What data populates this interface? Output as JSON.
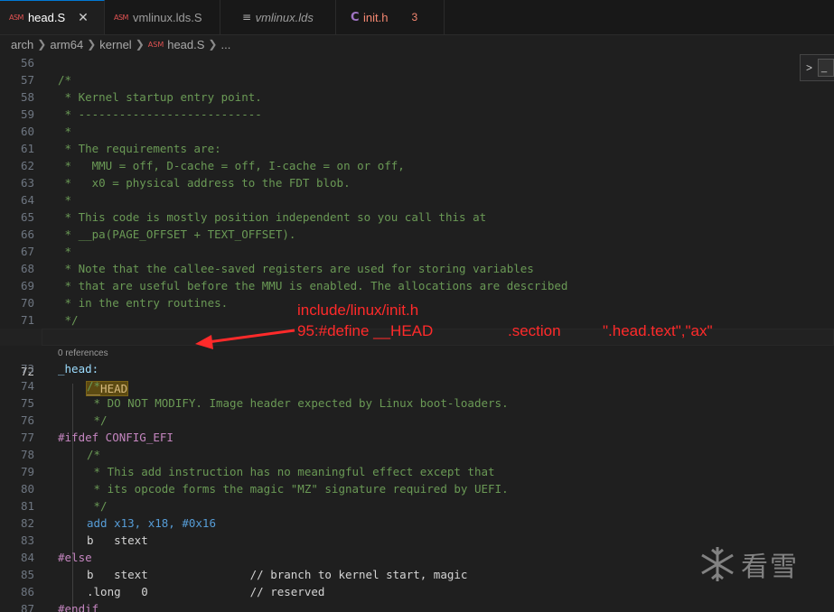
{
  "tabs": [
    {
      "icon": "ASM",
      "label": "head.S",
      "active": true,
      "close": "✕"
    },
    {
      "icon": "ASM",
      "label": "vmlinux.lds.S"
    },
    {
      "icon": "≡",
      "label": "vmlinux.lds",
      "italic": true
    },
    {
      "icon": "C",
      "label": "init.h",
      "problems": "3"
    }
  ],
  "breadcrumb": [
    "arch",
    "arm64",
    "kernel",
    "head.S",
    "..."
  ],
  "breadcrumb_file_icon": "ASM",
  "find_widget": {
    "chevron": ">",
    "value": "_"
  },
  "codelens_text": "0 references",
  "annotation": {
    "line1": "include/linux/init.h",
    "line2a": "95:#define __HEAD",
    "line2b": ".section",
    "line2c": "\".head.text\",\"ax\""
  },
  "watermark": {
    "text": "看雪"
  },
  "lines": [
    {
      "n": "56",
      "t": ""
    },
    {
      "n": "57",
      "t": "/*"
    },
    {
      "n": "58",
      "t": " * Kernel startup entry point."
    },
    {
      "n": "59",
      "t": " * ---------------------------"
    },
    {
      "n": "60",
      "t": " *"
    },
    {
      "n": "61",
      "t": " * The requirements are:"
    },
    {
      "n": "62",
      "t": " *   MMU = off, D-cache = off, I-cache = on or off,"
    },
    {
      "n": "63",
      "t": " *   x0 = physical address to the FDT blob."
    },
    {
      "n": "64",
      "t": " *"
    },
    {
      "n": "65",
      "t": " * This code is mostly position independent so you call this at"
    },
    {
      "n": "66",
      "t": " * __pa(PAGE_OFFSET + TEXT_OFFSET)."
    },
    {
      "n": "67",
      "t": " *"
    },
    {
      "n": "68",
      "t": " * Note that the callee-saved registers are used for storing variables"
    },
    {
      "n": "69",
      "t": " * that are useful before the MMU is enabled. The allocations are described"
    },
    {
      "n": "70",
      "t": " * in the entry routines."
    },
    {
      "n": "71",
      "t": " */"
    },
    {
      "n": "72",
      "t": "__HEAD"
    },
    {
      "n": "73",
      "t": "_head:"
    },
    {
      "n": "74",
      "t": "/*"
    },
    {
      "n": "75",
      "t": " * DO NOT MODIFY. Image header expected by Linux boot-loaders."
    },
    {
      "n": "76",
      "t": " */"
    },
    {
      "n": "77",
      "t": "#ifdef CONFIG_EFI"
    },
    {
      "n": "78",
      "t": "/*"
    },
    {
      "n": "79",
      "t": " * This add instruction has no meaningful effect except that"
    },
    {
      "n": "80",
      "t": " * its opcode forms the magic \"MZ\" signature required by UEFI."
    },
    {
      "n": "81",
      "t": " */"
    },
    {
      "n": "82",
      "t": "add x13, x18, #0x16"
    },
    {
      "n": "83",
      "t": "b   stext"
    },
    {
      "n": "84",
      "t": "#else"
    },
    {
      "n": "85",
      "t": "b   stext               // branch to kernel start, magic"
    },
    {
      "n": "86",
      "t": ".long   0               // reserved"
    },
    {
      "n": "87",
      "t": "#endif"
    }
  ]
}
